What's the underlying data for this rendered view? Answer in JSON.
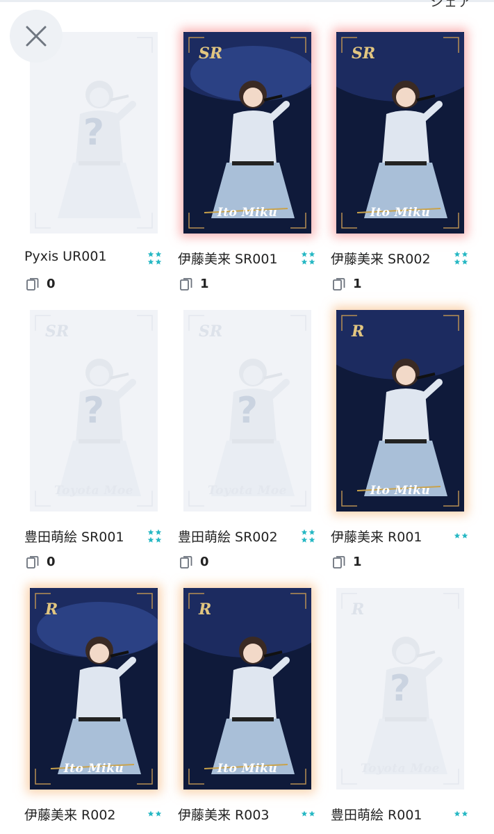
{
  "header": {
    "share_label": "シェア"
  },
  "colors": {
    "star_accent": "#27b8c4",
    "sr_glow": "#f57878",
    "r_glow": "#f5af6e"
  },
  "cards": [
    {
      "name": "Pyxis UR001",
      "count": "0",
      "rank": "",
      "signature": "",
      "unlocked": false,
      "glow": "",
      "rare_stars": true,
      "placeholder": "?"
    },
    {
      "name": "伊藤美来 SR001",
      "count": "1",
      "rank": "SR",
      "signature": "Ito Miku",
      "unlocked": true,
      "glow": "sr",
      "rare_stars": true,
      "placeholder": ""
    },
    {
      "name": "伊藤美来 SR002",
      "count": "1",
      "rank": "SR",
      "signature": "Ito Miku",
      "unlocked": true,
      "glow": "sr",
      "rare_stars": true,
      "placeholder": ""
    },
    {
      "name": "豊田萌絵 SR001",
      "count": "0",
      "rank": "SR",
      "signature": "Toyota Moe",
      "unlocked": false,
      "glow": "",
      "rare_stars": true,
      "placeholder": "?"
    },
    {
      "name": "豊田萌絵 SR002",
      "count": "0",
      "rank": "SR",
      "signature": "Toyota Moe",
      "unlocked": false,
      "glow": "",
      "rare_stars": true,
      "placeholder": "?"
    },
    {
      "name": "伊藤美来 R001",
      "count": "1",
      "rank": "R",
      "signature": "Ito Miku",
      "unlocked": true,
      "glow": "r",
      "rare_stars": false,
      "placeholder": ""
    },
    {
      "name": "伊藤美来 R002",
      "count": "",
      "rank": "R",
      "signature": "Ito Miku",
      "unlocked": true,
      "glow": "r",
      "rare_stars": false,
      "placeholder": ""
    },
    {
      "name": "伊藤美来 R003",
      "count": "",
      "rank": "R",
      "signature": "Ito Miku",
      "unlocked": true,
      "glow": "r",
      "rare_stars": false,
      "placeholder": ""
    },
    {
      "name": "豊田萌絵 R001",
      "count": "",
      "rank": "R",
      "signature": "Toyota Moe",
      "unlocked": false,
      "glow": "",
      "rare_stars": false,
      "placeholder": "?"
    }
  ]
}
